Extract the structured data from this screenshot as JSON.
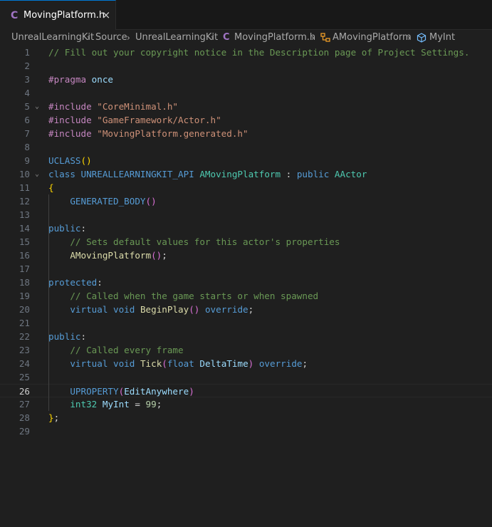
{
  "tab": {
    "icon": "C",
    "label": "MovingPlatform.h",
    "close": "×"
  },
  "breadcrumb": {
    "items": [
      "UnrealLearningKit",
      "Source",
      "UnrealLearningKit",
      "MovingPlatform.h",
      "AMovingPlatform",
      "MyInt"
    ],
    "file_icon": "C",
    "class_icon": "class-symbol-icon",
    "field_icon": "field-cube-icon"
  },
  "editor": {
    "active_line": 26,
    "lines": [
      {
        "n": "1",
        "tokens": [
          [
            "c-com",
            "// Fill out your copyright notice in the Description page of Project Settings."
          ]
        ]
      },
      {
        "n": "2",
        "tokens": []
      },
      {
        "n": "3",
        "tokens": [
          [
            "c-pp",
            "#pragma"
          ],
          [
            "c-txt",
            " "
          ],
          [
            "c-var",
            "once"
          ]
        ]
      },
      {
        "n": "4",
        "tokens": []
      },
      {
        "n": "5",
        "tokens": [
          [
            "c-pp",
            "#include"
          ],
          [
            "c-txt",
            " "
          ],
          [
            "c-str",
            "\"CoreMinimal.h\""
          ]
        ]
      },
      {
        "n": "6",
        "tokens": [
          [
            "c-pp",
            "#include"
          ],
          [
            "c-txt",
            " "
          ],
          [
            "c-str",
            "\"GameFramework/Actor.h\""
          ]
        ]
      },
      {
        "n": "7",
        "tokens": [
          [
            "c-pp",
            "#include"
          ],
          [
            "c-txt",
            " "
          ],
          [
            "c-str",
            "\"MovingPlatform.generated.h\""
          ]
        ]
      },
      {
        "n": "8",
        "tokens": []
      },
      {
        "n": "9",
        "tokens": [
          [
            "c-mac",
            "UCLASS"
          ],
          [
            "c-brk1",
            "()"
          ]
        ]
      },
      {
        "n": "10",
        "tokens": [
          [
            "c-kw",
            "class"
          ],
          [
            "c-txt",
            " "
          ],
          [
            "c-mac",
            "UNREALLEARNINGKIT_API"
          ],
          [
            "c-txt",
            " "
          ],
          [
            "c-cls",
            "AMovingPlatform"
          ],
          [
            "c-txt",
            " : "
          ],
          [
            "c-kw",
            "public"
          ],
          [
            "c-txt",
            " "
          ],
          [
            "c-cls",
            "AActor"
          ]
        ]
      },
      {
        "n": "11",
        "tokens": [
          [
            "c-brk1",
            "{"
          ]
        ]
      },
      {
        "n": "12",
        "tokens": [
          [
            "c-txt",
            "    "
          ],
          [
            "c-mac",
            "GENERATED_BODY"
          ],
          [
            "c-brk2",
            "()"
          ]
        ]
      },
      {
        "n": "13",
        "tokens": []
      },
      {
        "n": "14",
        "tokens": [
          [
            "c-kw",
            "public"
          ],
          [
            "c-txt",
            ":"
          ]
        ]
      },
      {
        "n": "15",
        "tokens": [
          [
            "c-txt",
            "    "
          ],
          [
            "c-com",
            "// Sets default values for this actor's properties"
          ]
        ]
      },
      {
        "n": "16",
        "tokens": [
          [
            "c-txt",
            "    "
          ],
          [
            "c-fn",
            "AMovingPlatform"
          ],
          [
            "c-brk2",
            "()"
          ],
          [
            "c-txt",
            ";"
          ]
        ]
      },
      {
        "n": "17",
        "tokens": []
      },
      {
        "n": "18",
        "tokens": [
          [
            "c-kw",
            "protected"
          ],
          [
            "c-txt",
            ":"
          ]
        ]
      },
      {
        "n": "19",
        "tokens": [
          [
            "c-txt",
            "    "
          ],
          [
            "c-com",
            "// Called when the game starts or when spawned"
          ]
        ]
      },
      {
        "n": "20",
        "tokens": [
          [
            "c-txt",
            "    "
          ],
          [
            "c-kw",
            "virtual"
          ],
          [
            "c-txt",
            " "
          ],
          [
            "c-kw",
            "void"
          ],
          [
            "c-txt",
            " "
          ],
          [
            "c-fn",
            "BeginPlay"
          ],
          [
            "c-brk2",
            "()"
          ],
          [
            "c-txt",
            " "
          ],
          [
            "c-kw",
            "override"
          ],
          [
            "c-txt",
            ";"
          ]
        ]
      },
      {
        "n": "21",
        "tokens": []
      },
      {
        "n": "22",
        "tokens": [
          [
            "c-kw",
            "public"
          ],
          [
            "c-txt",
            ":"
          ]
        ]
      },
      {
        "n": "23",
        "tokens": [
          [
            "c-txt",
            "    "
          ],
          [
            "c-com",
            "// Called every frame"
          ]
        ]
      },
      {
        "n": "24",
        "tokens": [
          [
            "c-txt",
            "    "
          ],
          [
            "c-kw",
            "virtual"
          ],
          [
            "c-txt",
            " "
          ],
          [
            "c-kw",
            "void"
          ],
          [
            "c-txt",
            " "
          ],
          [
            "c-fn",
            "Tick"
          ],
          [
            "c-brk2",
            "("
          ],
          [
            "c-kw",
            "float"
          ],
          [
            "c-txt",
            " "
          ],
          [
            "c-var",
            "DeltaTime"
          ],
          [
            "c-brk2",
            ")"
          ],
          [
            "c-txt",
            " "
          ],
          [
            "c-kw",
            "override"
          ],
          [
            "c-txt",
            ";"
          ]
        ]
      },
      {
        "n": "25",
        "tokens": []
      },
      {
        "n": "26",
        "tokens": [
          [
            "c-txt",
            "    "
          ],
          [
            "c-mac",
            "UPROPERTY"
          ],
          [
            "c-brk2",
            "("
          ],
          [
            "c-var",
            "EditAnywhere"
          ],
          [
            "c-brk2",
            ")"
          ]
        ]
      },
      {
        "n": "27",
        "tokens": [
          [
            "c-txt",
            "    "
          ],
          [
            "c-type",
            "int32"
          ],
          [
            "c-txt",
            " "
          ],
          [
            "c-var",
            "MyInt"
          ],
          [
            "c-txt",
            " = "
          ],
          [
            "c-num",
            "99"
          ],
          [
            "c-txt",
            ";"
          ]
        ]
      },
      {
        "n": "28",
        "tokens": [
          [
            "c-brk1",
            "}"
          ],
          [
            "c-txt",
            ";"
          ]
        ]
      },
      {
        "n": "29",
        "tokens": []
      }
    ],
    "folds": [
      "5",
      "10"
    ]
  }
}
